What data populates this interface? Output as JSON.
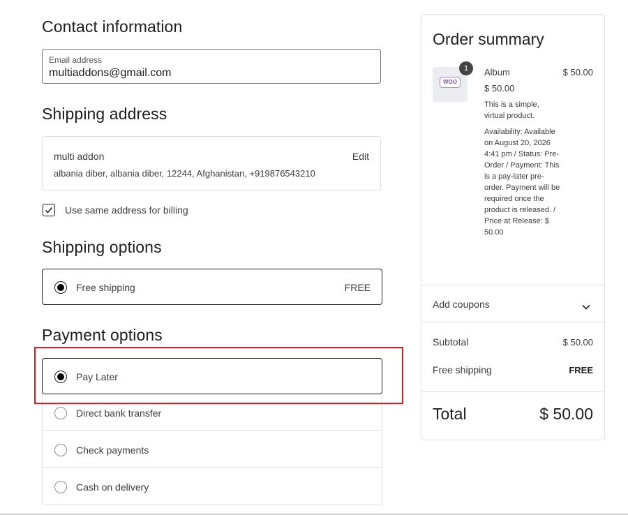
{
  "contact": {
    "heading": "Contact information",
    "email_label": "Email address",
    "email_value": "multiaddons@gmail.com"
  },
  "shipping_address": {
    "heading": "Shipping address",
    "name": "multi addon",
    "address_line": "albania diber, albania diber, 12244, Afghanistan, +919876543210",
    "edit_label": "Edit",
    "same_billing_label": "Use same address for billing",
    "same_billing_checked": true
  },
  "shipping_options": {
    "heading": "Shipping options",
    "selected_label": "Free shipping",
    "selected_price": "FREE"
  },
  "payment_options": {
    "heading": "Payment options",
    "options": [
      {
        "label": "Pay Later",
        "selected": true
      },
      {
        "label": "Direct bank transfer",
        "selected": false
      },
      {
        "label": "Check payments",
        "selected": false
      },
      {
        "label": "Cash on delivery",
        "selected": false
      }
    ]
  },
  "highlight_color": "#e8191a",
  "summary": {
    "heading": "Order summary",
    "item": {
      "quantity_badge": "1",
      "thumb_logo": "WOO",
      "name": "Album",
      "line_total": "$ 50.00",
      "price": "$ 50.00",
      "description": "This is a simple, virtual product.",
      "meta": "Availability: Available on August 20, 2026 4:41 pm / Status: Pre-Order / Payment: This is a pay-later pre-order. Payment will be required once the product is released. / Price at Release: $ 50.00"
    },
    "coupon_label": "Add coupons",
    "subtotal_label": "Subtotal",
    "subtotal_value": "$ 50.00",
    "shipping_label": "Free shipping",
    "shipping_value": "FREE",
    "total_label": "Total",
    "total_value": "$ 50.00"
  }
}
